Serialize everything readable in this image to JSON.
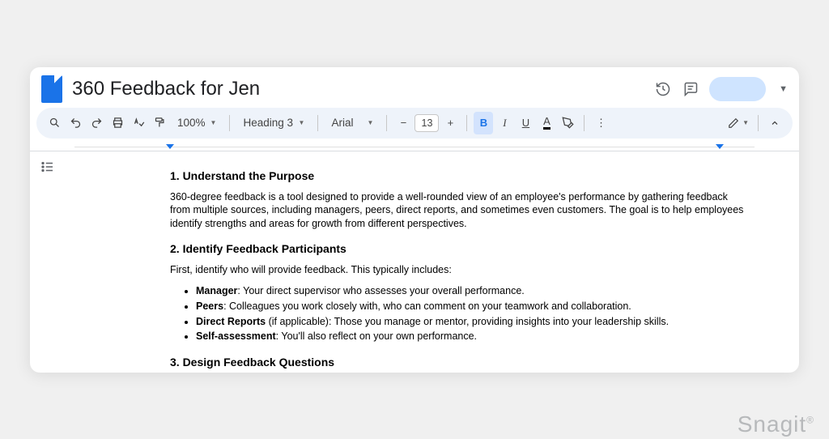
{
  "header": {
    "title": "360 Feedback for Jen"
  },
  "toolbar": {
    "zoom": "100%",
    "style": "Heading 3",
    "font": "Arial",
    "font_size": "13"
  },
  "doc": {
    "s1": {
      "heading": "1. Understand the Purpose",
      "body": "360-degree feedback is a tool designed to provide a well-rounded view of an employee's performance by gathering feedback from multiple sources, including managers, peers, direct reports, and sometimes even customers. The goal is to help employees identify strengths and areas for growth from different perspectives."
    },
    "s2": {
      "heading": "2. Identify Feedback Participants",
      "intro": "First, identify who will provide feedback. This typically includes:",
      "items": [
        {
          "label": "Manager",
          "rest": ": Your direct supervisor who assesses your overall performance."
        },
        {
          "label": "Peers",
          "rest": ": Colleagues you work closely with, who can comment on your teamwork and collaboration."
        },
        {
          "label": "Direct Reports",
          "rest": " (if applicable): Those you manage or mentor, providing insights into your leadership skills."
        },
        {
          "label": "Self-assessment",
          "rest": ": You'll also reflect on your own performance."
        }
      ]
    },
    "s3": {
      "heading": "3. Design Feedback Questions"
    }
  },
  "watermark": "Snagit"
}
